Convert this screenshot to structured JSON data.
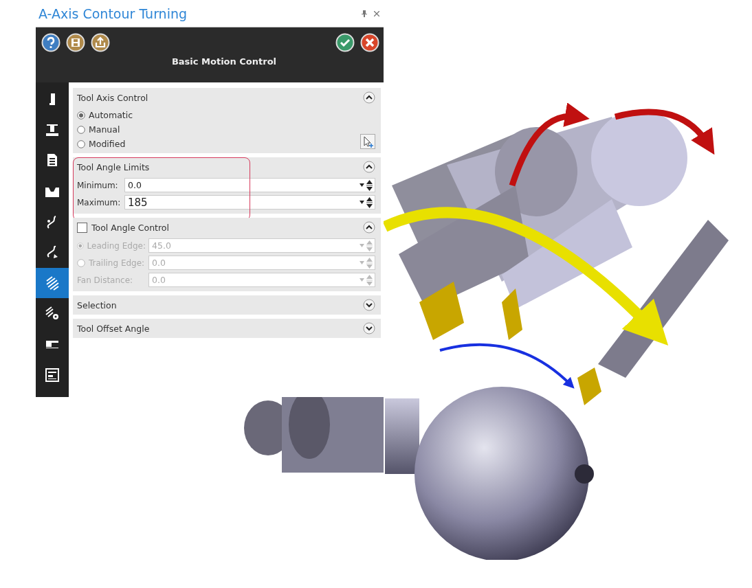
{
  "window": {
    "title": "A-Axis Contour Turning"
  },
  "header": {
    "title": "Basic Motion Control"
  },
  "sidebar": {
    "items": [
      {
        "kind": "tool",
        "selected": false
      },
      {
        "kind": "machine",
        "selected": false
      },
      {
        "kind": "list",
        "selected": false
      },
      {
        "kind": "stock",
        "selected": false
      },
      {
        "kind": "link",
        "selected": false
      },
      {
        "kind": "link-arrow",
        "selected": false
      },
      {
        "kind": "pattern",
        "selected": true
      },
      {
        "kind": "pattern-gear",
        "selected": false
      },
      {
        "kind": "post",
        "selected": false
      },
      {
        "kind": "form",
        "selected": false
      }
    ]
  },
  "sections": [
    {
      "kind": "radio_group",
      "title": "Tool Axis Control",
      "expanded": true,
      "options": [
        {
          "label": "Automatic",
          "selected": true
        },
        {
          "label": "Manual",
          "selected": false
        },
        {
          "label": "Modified",
          "selected": false
        }
      ]
    },
    {
      "kind": "fields",
      "title": "Tool Angle Limits",
      "expanded": true,
      "highlighted": true,
      "fields": [
        {
          "kind": "plain",
          "label": "Minimum:",
          "value": "0.0",
          "disabled": false
        },
        {
          "kind": "plain",
          "label": "Maximum:",
          "value": "185",
          "disabled": false
        }
      ]
    },
    {
      "kind": "fields",
      "title": "Tool Angle Control",
      "checkbox": true,
      "checked": false,
      "expanded": true,
      "fields": [
        {
          "kind": "radio",
          "label": "Leading Edge:",
          "value": "45.0",
          "selected": true,
          "disabled": true
        },
        {
          "kind": "radio",
          "label": "Trailing Edge:",
          "value": "0.0",
          "selected": false,
          "disabled": true
        },
        {
          "kind": "plain",
          "label": "Fan Distance:",
          "value": "0.0",
          "disabled": true
        }
      ]
    },
    {
      "kind": "header_only",
      "title": "Selection",
      "expanded": false
    },
    {
      "kind": "header_only",
      "title": "Tool Offset Angle",
      "expanded": false
    }
  ]
}
